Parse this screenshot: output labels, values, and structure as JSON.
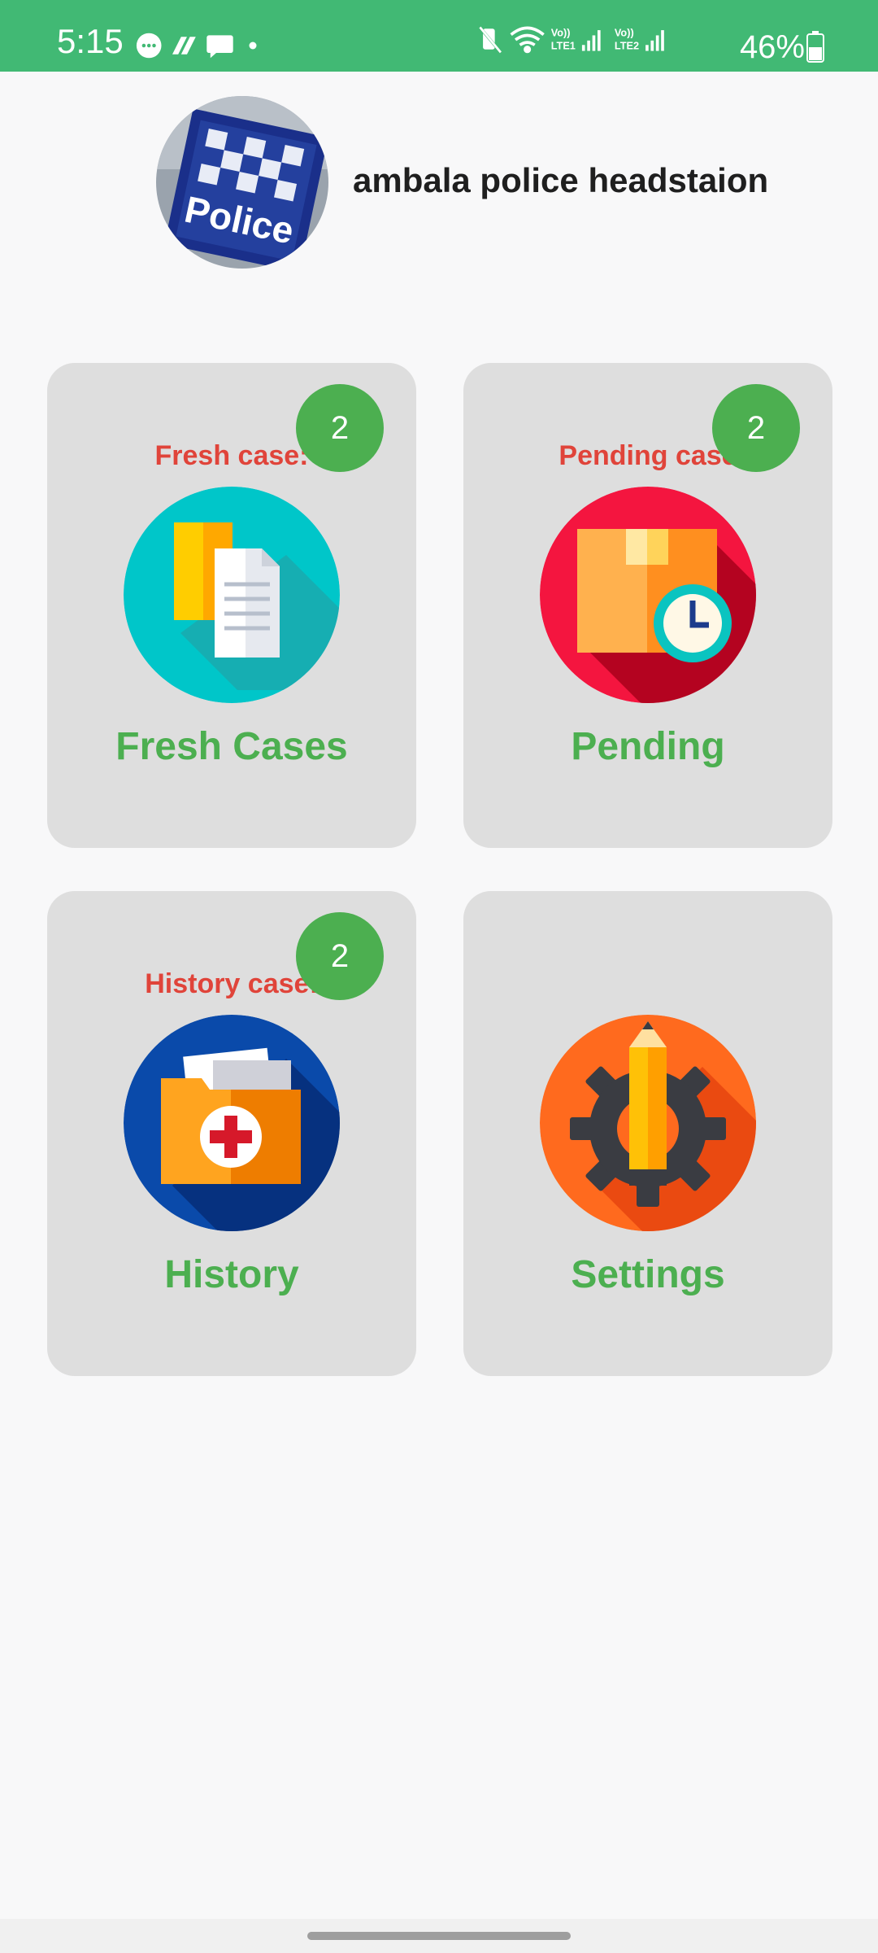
{
  "status_bar": {
    "time": "5:15",
    "battery": "46%",
    "background_color": "#41b974",
    "left_icons": [
      "chat-bubble-icon",
      "app-notification-icon",
      "message-icon",
      "dot-icon"
    ],
    "right_icons": [
      "vibrate-mute-icon",
      "wifi-icon",
      "signal-lte1-icon",
      "signal-lte2-icon",
      "battery-icon"
    ],
    "lte1_label": "Vo)) LTE1",
    "lte2_label": "Vo)) LTE2"
  },
  "header": {
    "title": "ambala police headstaion",
    "avatar_icon": "police-sign-avatar",
    "avatar_text": "Police"
  },
  "cards": [
    {
      "label": "Fresh case:",
      "badge": "2",
      "title": "Fresh Cases",
      "icon": "documents-icon",
      "icon_color": "#00c6c9"
    },
    {
      "label": "Pending case",
      "badge": "2",
      "title": "Pending",
      "icon": "box-clock-icon",
      "icon_color": "#f4153f"
    },
    {
      "label": "History case:",
      "badge": "2",
      "title": "History",
      "icon": "medical-folder-icon",
      "icon_color": "#0a4aaa"
    },
    {
      "label": "",
      "badge": "",
      "title": "Settings",
      "icon": "gear-pencil-icon",
      "icon_color": "#ff6a1e"
    }
  ],
  "colors": {
    "card_background": "#dedede",
    "label_red": "#e0443a",
    "title_green": "#4caf50",
    "badge_green": "#4caf50"
  }
}
